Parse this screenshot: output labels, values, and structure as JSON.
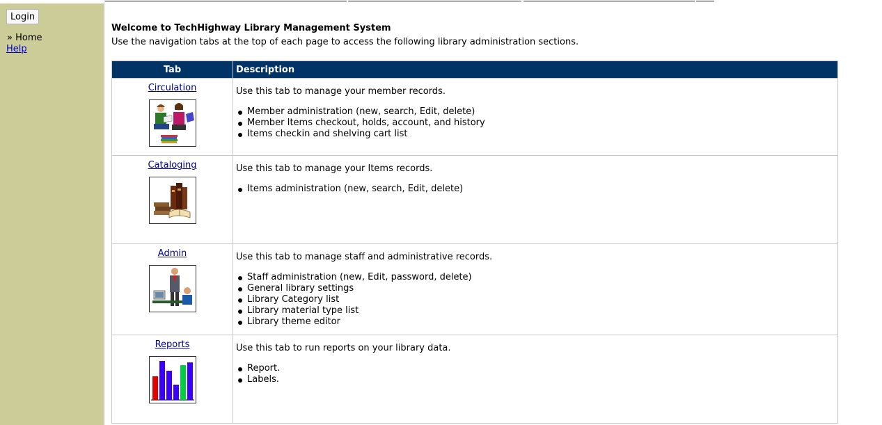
{
  "sidebar": {
    "login_label": "Login",
    "home_label": "» Home",
    "help_label": "Help"
  },
  "main": {
    "title": "Welcome to TechHighway Library Management System",
    "intro": "Use the navigation tabs at the top of each page to access the following library administration sections."
  },
  "table": {
    "headers": [
      "Tab",
      "Description"
    ],
    "rows": [
      {
        "tab": "Circulation",
        "icon": "circulation-readers-icon",
        "desc": "Use this tab to manage your member records.",
        "items": [
          "Member administration (new, search, Edit, delete)",
          "Member Items checkout, holds, account, and history",
          "Items checkin and shelving cart list"
        ]
      },
      {
        "tab": "Cataloging",
        "icon": "cataloging-books-icon",
        "desc": "Use this tab to manage your Items records.",
        "items": [
          "Items administration (new, search, Edit, delete)"
        ]
      },
      {
        "tab": "Admin",
        "icon": "admin-staff-icon",
        "desc": "Use this tab to manage staff and administrative records.",
        "items": [
          "Staff administration (new, Edit, password, delete)",
          "General library settings",
          "Library Category list",
          "Library material type list",
          "Library theme editor"
        ]
      },
      {
        "tab": "Reports",
        "icon": "reports-bar-chart-icon",
        "desc": "Use this tab to run reports on your library data.",
        "items": [
          "Report.",
          "Labels."
        ]
      }
    ]
  },
  "colors": {
    "sidebar": "#cccc99",
    "header": "#003366",
    "link": "#00008b"
  }
}
